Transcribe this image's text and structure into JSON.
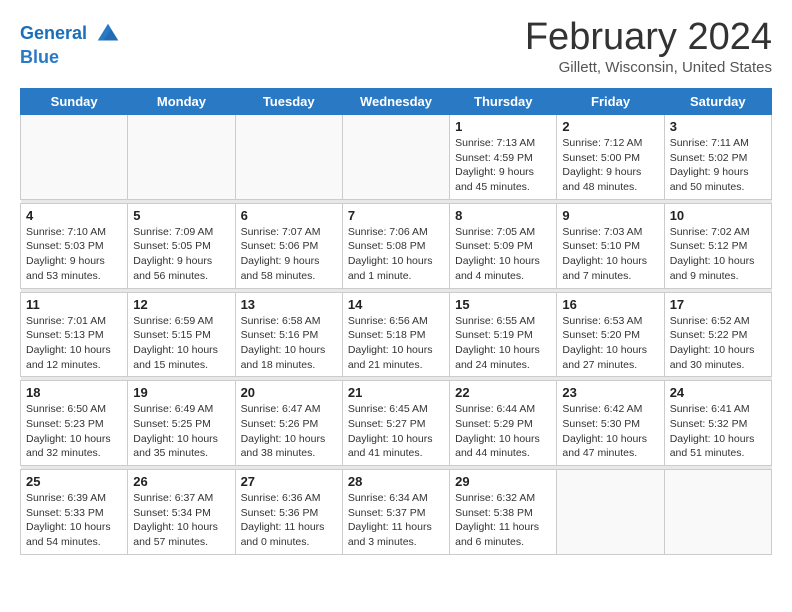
{
  "header": {
    "logo_line1": "General",
    "logo_line2": "Blue",
    "title": "February 2024",
    "subtitle": "Gillett, Wisconsin, United States"
  },
  "days": [
    "Sunday",
    "Monday",
    "Tuesday",
    "Wednesday",
    "Thursday",
    "Friday",
    "Saturday"
  ],
  "weeks": [
    [
      {
        "date": "",
        "info": ""
      },
      {
        "date": "",
        "info": ""
      },
      {
        "date": "",
        "info": ""
      },
      {
        "date": "",
        "info": ""
      },
      {
        "date": "1",
        "info": "Sunrise: 7:13 AM\nSunset: 4:59 PM\nDaylight: 9 hours\nand 45 minutes."
      },
      {
        "date": "2",
        "info": "Sunrise: 7:12 AM\nSunset: 5:00 PM\nDaylight: 9 hours\nand 48 minutes."
      },
      {
        "date": "3",
        "info": "Sunrise: 7:11 AM\nSunset: 5:02 PM\nDaylight: 9 hours\nand 50 minutes."
      }
    ],
    [
      {
        "date": "4",
        "info": "Sunrise: 7:10 AM\nSunset: 5:03 PM\nDaylight: 9 hours\nand 53 minutes."
      },
      {
        "date": "5",
        "info": "Sunrise: 7:09 AM\nSunset: 5:05 PM\nDaylight: 9 hours\nand 56 minutes."
      },
      {
        "date": "6",
        "info": "Sunrise: 7:07 AM\nSunset: 5:06 PM\nDaylight: 9 hours\nand 58 minutes."
      },
      {
        "date": "7",
        "info": "Sunrise: 7:06 AM\nSunset: 5:08 PM\nDaylight: 10 hours\nand 1 minute."
      },
      {
        "date": "8",
        "info": "Sunrise: 7:05 AM\nSunset: 5:09 PM\nDaylight: 10 hours\nand 4 minutes."
      },
      {
        "date": "9",
        "info": "Sunrise: 7:03 AM\nSunset: 5:10 PM\nDaylight: 10 hours\nand 7 minutes."
      },
      {
        "date": "10",
        "info": "Sunrise: 7:02 AM\nSunset: 5:12 PM\nDaylight: 10 hours\nand 9 minutes."
      }
    ],
    [
      {
        "date": "11",
        "info": "Sunrise: 7:01 AM\nSunset: 5:13 PM\nDaylight: 10 hours\nand 12 minutes."
      },
      {
        "date": "12",
        "info": "Sunrise: 6:59 AM\nSunset: 5:15 PM\nDaylight: 10 hours\nand 15 minutes."
      },
      {
        "date": "13",
        "info": "Sunrise: 6:58 AM\nSunset: 5:16 PM\nDaylight: 10 hours\nand 18 minutes."
      },
      {
        "date": "14",
        "info": "Sunrise: 6:56 AM\nSunset: 5:18 PM\nDaylight: 10 hours\nand 21 minutes."
      },
      {
        "date": "15",
        "info": "Sunrise: 6:55 AM\nSunset: 5:19 PM\nDaylight: 10 hours\nand 24 minutes."
      },
      {
        "date": "16",
        "info": "Sunrise: 6:53 AM\nSunset: 5:20 PM\nDaylight: 10 hours\nand 27 minutes."
      },
      {
        "date": "17",
        "info": "Sunrise: 6:52 AM\nSunset: 5:22 PM\nDaylight: 10 hours\nand 30 minutes."
      }
    ],
    [
      {
        "date": "18",
        "info": "Sunrise: 6:50 AM\nSunset: 5:23 PM\nDaylight: 10 hours\nand 32 minutes."
      },
      {
        "date": "19",
        "info": "Sunrise: 6:49 AM\nSunset: 5:25 PM\nDaylight: 10 hours\nand 35 minutes."
      },
      {
        "date": "20",
        "info": "Sunrise: 6:47 AM\nSunset: 5:26 PM\nDaylight: 10 hours\nand 38 minutes."
      },
      {
        "date": "21",
        "info": "Sunrise: 6:45 AM\nSunset: 5:27 PM\nDaylight: 10 hours\nand 41 minutes."
      },
      {
        "date": "22",
        "info": "Sunrise: 6:44 AM\nSunset: 5:29 PM\nDaylight: 10 hours\nand 44 minutes."
      },
      {
        "date": "23",
        "info": "Sunrise: 6:42 AM\nSunset: 5:30 PM\nDaylight: 10 hours\nand 47 minutes."
      },
      {
        "date": "24",
        "info": "Sunrise: 6:41 AM\nSunset: 5:32 PM\nDaylight: 10 hours\nand 51 minutes."
      }
    ],
    [
      {
        "date": "25",
        "info": "Sunrise: 6:39 AM\nSunset: 5:33 PM\nDaylight: 10 hours\nand 54 minutes."
      },
      {
        "date": "26",
        "info": "Sunrise: 6:37 AM\nSunset: 5:34 PM\nDaylight: 10 hours\nand 57 minutes."
      },
      {
        "date": "27",
        "info": "Sunrise: 6:36 AM\nSunset: 5:36 PM\nDaylight: 11 hours\nand 0 minutes."
      },
      {
        "date": "28",
        "info": "Sunrise: 6:34 AM\nSunset: 5:37 PM\nDaylight: 11 hours\nand 3 minutes."
      },
      {
        "date": "29",
        "info": "Sunrise: 6:32 AM\nSunset: 5:38 PM\nDaylight: 11 hours\nand 6 minutes."
      },
      {
        "date": "",
        "info": ""
      },
      {
        "date": "",
        "info": ""
      }
    ]
  ]
}
